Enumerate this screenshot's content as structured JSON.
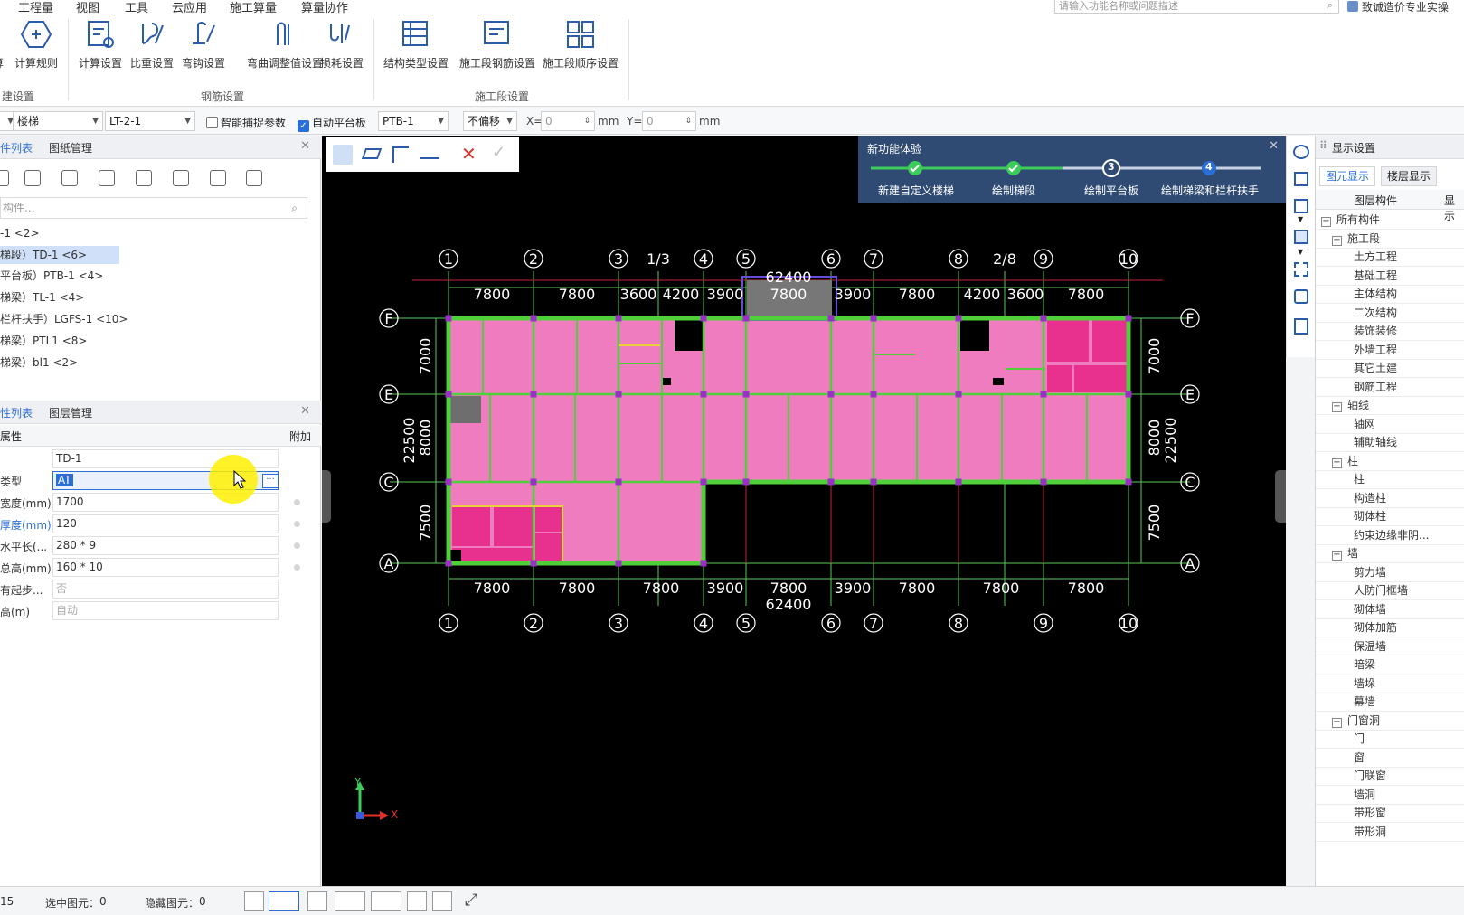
{
  "menu": {
    "items": [
      "工程量",
      "视图",
      "工具",
      "云应用",
      "施工算量",
      "算量协作"
    ],
    "search_placeholder": "请输入功能名称或问题描述",
    "user": "致诚造价专业实操"
  },
  "ribbon": {
    "buttons": [
      "算",
      "计算规则",
      "计算设置",
      "比重设置",
      "弯钩设置",
      "弯曲调整值设置",
      "损耗设置",
      "结构类型设置",
      "施工段钢筋设置",
      "施工段顺序设置"
    ],
    "groups": [
      "建设置",
      "钢筋设置",
      "施工段设置"
    ]
  },
  "propbar": {
    "type_select": "楼梯",
    "name_select": "LT-2-1",
    "smart_capture_label": "智能捕捉参数",
    "smart_capture_checked": false,
    "auto_platform_label": "自动平台板",
    "auto_platform_checked": true,
    "platform_select": "PTB-1",
    "offset_select": "不偏移",
    "x_label": "X=",
    "x_value": "0",
    "y_label": "Y=",
    "y_value": "0",
    "unit": "mm"
  },
  "component_panel": {
    "tabs": [
      "件列表",
      "图纸管理"
    ],
    "search_placeholder": "构件...",
    "items": [
      {
        "label": "-1 <2>"
      },
      {
        "label": "梯段）TD-1 <6>"
      },
      {
        "label": "平台板）PTB-1 <4>"
      },
      {
        "label": "梯梁）TL-1 <4>"
      },
      {
        "label": "栏杆扶手）LGFS-1 <10>"
      },
      {
        "label": "梯梁）PTL1 <8>"
      },
      {
        "label": "梯梁）bl1 <2>"
      }
    ]
  },
  "property_panel": {
    "tabs": [
      "性列表",
      "图层管理"
    ],
    "header_name": "属性",
    "header_extra": "附加",
    "rows": [
      {
        "name": "",
        "value": "TD-1"
      },
      {
        "name": "类型",
        "value": "AT"
      },
      {
        "name": "宽度(mm)",
        "value": "1700"
      },
      {
        "name": "厚度(mm)",
        "value": "120"
      },
      {
        "name": "水平长(...",
        "value": "280 * 9"
      },
      {
        "name": "总高(mm)",
        "value": "160 * 10"
      },
      {
        "name": "有起步...",
        "value": "否"
      },
      {
        "name": "高(m)",
        "value": "自动"
      }
    ]
  },
  "guide": {
    "title": "新功能体验",
    "steps": [
      {
        "label": "新建自定义楼梯",
        "done": true
      },
      {
        "label": "绘制梯段",
        "done": true
      },
      {
        "label": "绘制平台板",
        "num": "3",
        "current": true
      },
      {
        "label": "绘制梯梁和栏杆扶手",
        "num": "4"
      }
    ]
  },
  "plan": {
    "top_axes": [
      "1",
      "2",
      "3",
      "1/3",
      "4",
      "5",
      "6",
      "7",
      "8",
      "2/8",
      "9",
      "10"
    ],
    "bottom_axes": [
      "1",
      "2",
      "3",
      "4",
      "5",
      "6",
      "7",
      "8",
      "9",
      "10"
    ],
    "side_axes": [
      "F",
      "E",
      "C",
      "A"
    ],
    "top_dims": [
      "7800",
      "7800",
      "3600",
      "4200",
      "3900",
      "7800",
      "3900",
      "7800",
      "4200",
      "3600",
      "7800"
    ],
    "bottom_dims": [
      "7800",
      "7800",
      "7800",
      "3900",
      "7800",
      "3900",
      "7800",
      "7800",
      "7800"
    ],
    "total": "62400",
    "side_dims": [
      "7000",
      "8000",
      "7500"
    ],
    "side_total": "22500",
    "axis_y": "Y",
    "axis_x": "X"
  },
  "display_panel": {
    "title": "显示设置",
    "tabs": [
      "图元显示",
      "楼层显示"
    ],
    "col_header": "图层构件",
    "col_header2": "显示",
    "tree": [
      {
        "label": "所有构件",
        "level": 0,
        "expander": "-"
      },
      {
        "label": "施工段",
        "level": 1,
        "expander": "-"
      },
      {
        "label": "土方工程",
        "level": 2
      },
      {
        "label": "基础工程",
        "level": 2
      },
      {
        "label": "主体结构",
        "level": 2
      },
      {
        "label": "二次结构",
        "level": 2
      },
      {
        "label": "装饰装修",
        "level": 2
      },
      {
        "label": "外墙工程",
        "level": 2
      },
      {
        "label": "其它土建",
        "level": 2
      },
      {
        "label": "钢筋工程",
        "level": 2
      },
      {
        "label": "轴线",
        "level": 1,
        "expander": "-"
      },
      {
        "label": "轴网",
        "level": 2
      },
      {
        "label": "辅助轴线",
        "level": 2
      },
      {
        "label": "柱",
        "level": 1,
        "expander": "-"
      },
      {
        "label": "柱",
        "level": 2
      },
      {
        "label": "构造柱",
        "level": 2
      },
      {
        "label": "砌体柱",
        "level": 2
      },
      {
        "label": "约束边缘非阴...",
        "level": 2
      },
      {
        "label": "墙",
        "level": 1,
        "expander": "-"
      },
      {
        "label": "剪力墙",
        "level": 2
      },
      {
        "label": "人防门框墙",
        "level": 2
      },
      {
        "label": "砌体墙",
        "level": 2
      },
      {
        "label": "砌体加筋",
        "level": 2
      },
      {
        "label": "保温墙",
        "level": 2
      },
      {
        "label": "暗梁",
        "level": 2
      },
      {
        "label": "墙垛",
        "level": 2
      },
      {
        "label": "幕墙",
        "level": 2
      },
      {
        "label": "门窗洞",
        "level": 1,
        "expander": "-"
      },
      {
        "label": "门",
        "level": 2
      },
      {
        "label": "窗",
        "level": 2
      },
      {
        "label": "门联窗",
        "level": 2
      },
      {
        "label": "墙洞",
        "level": 2
      },
      {
        "label": "带形窗",
        "level": 2
      },
      {
        "label": "带形洞",
        "level": 2
      }
    ]
  },
  "status": {
    "left_num": "15",
    "selected_label": "选中图元：",
    "selected_value": "0",
    "hidden_label": "隐藏图元：",
    "hidden_value": "0"
  },
  "colors": {
    "accent": "#2b6fd6",
    "guide_bg": "#2f4b73",
    "room_pink": "#f07cc0",
    "room_magenta": "#e8308f",
    "wall_green": "#4fd03a",
    "axis_green": "#57c957",
    "column_purple": "#9b2fc8",
    "canvas": "#000000"
  }
}
